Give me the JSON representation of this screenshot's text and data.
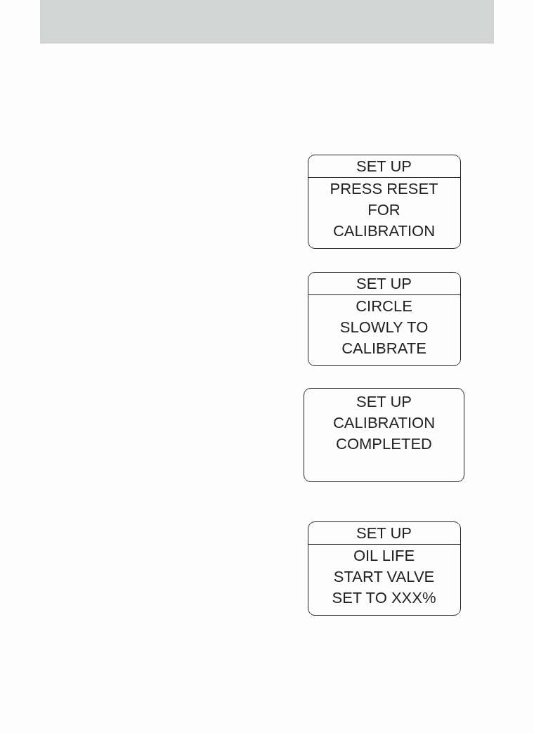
{
  "displays": [
    {
      "title": "SET UP",
      "divider": true,
      "lines": [
        "PRESS RESET",
        "FOR",
        "CALIBRATION"
      ]
    },
    {
      "title": "SET UP",
      "divider": true,
      "lines": [
        "CIRCLE",
        "SLOWLY TO",
        "CALIBRATE"
      ]
    },
    {
      "title": "SET UP",
      "divider": false,
      "lines": [
        "CALIBRATION",
        "COMPLETED"
      ]
    },
    {
      "title": "SET UP",
      "divider": true,
      "lines": [
        "OIL LIFE",
        "START VALVE",
        "SET TO XXX%"
      ]
    }
  ]
}
